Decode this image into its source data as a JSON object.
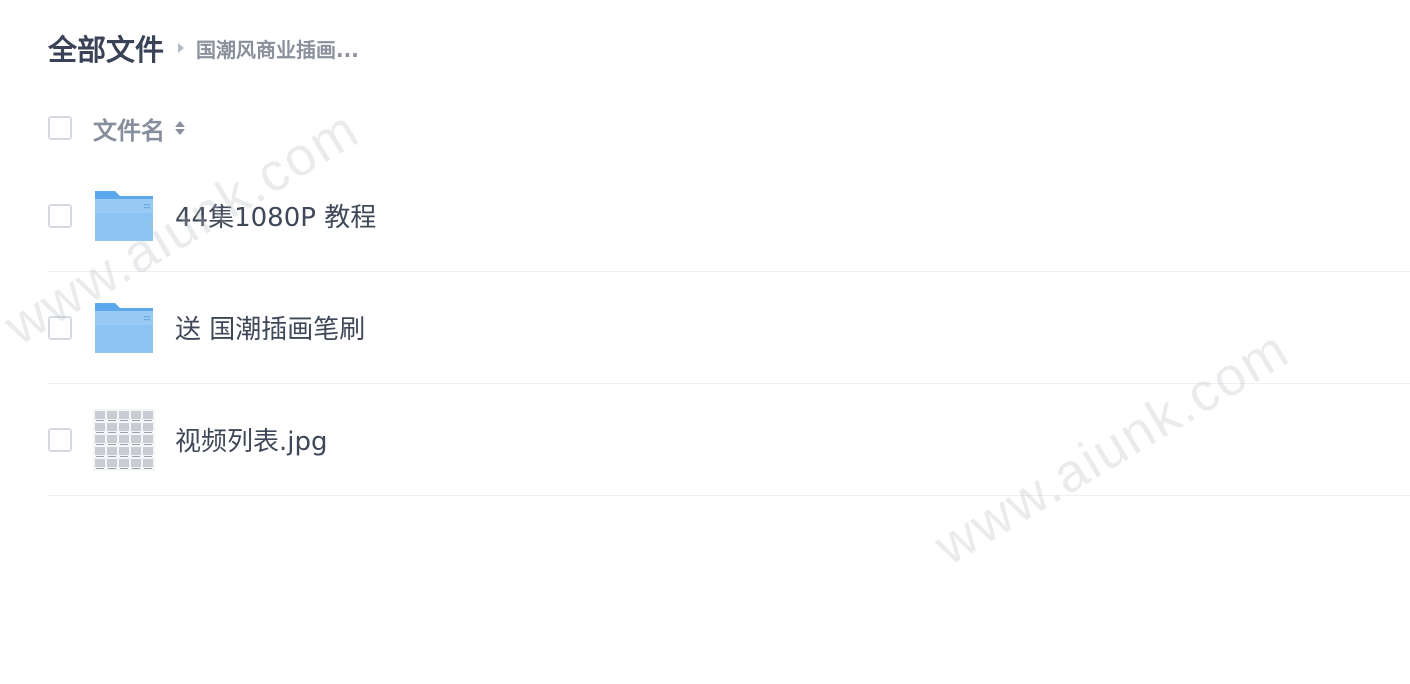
{
  "breadcrumb": {
    "root": "全部文件",
    "current": "国潮风商业插画..."
  },
  "list": {
    "column_name": "文件名",
    "files": [
      {
        "name": "44集1080P 教程",
        "type": "folder"
      },
      {
        "name": "送 国潮插画笔刷",
        "type": "folder"
      },
      {
        "name": "视频列表.jpg",
        "type": "image"
      }
    ]
  },
  "watermark": "www.aiunk.com",
  "colors": {
    "folder_top": "#5aa7ec",
    "folder_body": "#8cc4f3",
    "text_primary": "#3f4858",
    "text_muted": "#878e9b"
  }
}
